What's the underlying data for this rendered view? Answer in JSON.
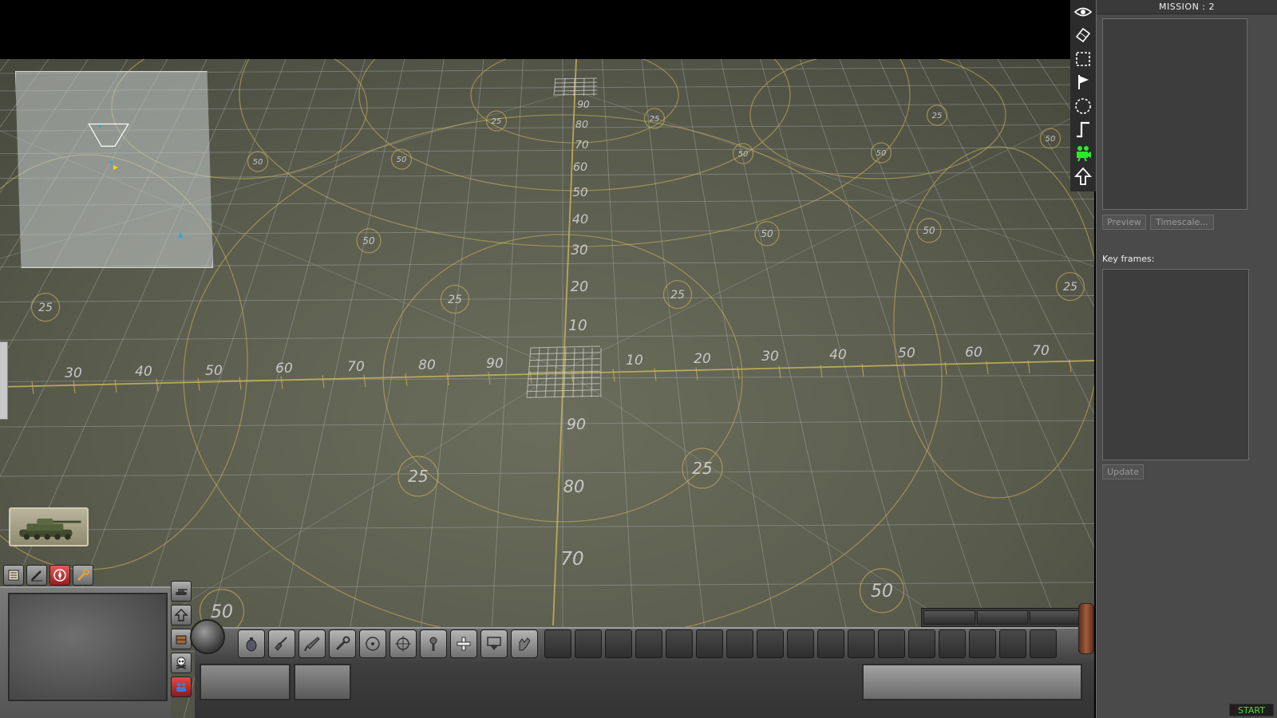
{
  "panel": {
    "title": "MISSION : 2",
    "preview_label": "Preview",
    "timescale_label": "Timescale...",
    "keyframes_label": "Key frames:",
    "update_label": "Update",
    "start_label": "START"
  },
  "tools": [
    {
      "name": "eye-icon",
      "active": false
    },
    {
      "name": "eraser-icon",
      "active": false
    },
    {
      "name": "selection-icon",
      "active": false
    },
    {
      "name": "flag-icon",
      "active": false
    },
    {
      "name": "circle-icon",
      "active": false
    },
    {
      "name": "path-icon",
      "active": false
    },
    {
      "name": "camera-icon",
      "active": true
    },
    {
      "name": "arrow-up-icon",
      "active": false
    }
  ],
  "map": {
    "range_labels_horizontal": [
      "30",
      "40",
      "50",
      "60",
      "70",
      "80",
      "90",
      "10",
      "20",
      "30",
      "40",
      "50",
      "60",
      "70"
    ],
    "range_labels_vertical_far": [
      "90",
      "80",
      "70",
      "60",
      "50",
      "40",
      "30",
      "20",
      "10"
    ],
    "range_labels_vertical_near": [
      "90",
      "80",
      "70"
    ],
    "ring_labels": [
      "25",
      "50"
    ],
    "line_color": "#c8b45a",
    "grid_color": "#b9bfc1"
  },
  "hud": {
    "tabs": [
      "list-icon",
      "pencil-icon",
      "compass-icon",
      "wrench-icon"
    ],
    "active_tab": "compass-icon",
    "vertical_buttons": [
      "tank-icon",
      "arrow-up-icon",
      "crate-icon",
      "skull-icon",
      "flag-team-icon"
    ],
    "actions": [
      "grenade-icon",
      "shovel-icon",
      "knife-icon",
      "wrench-icon",
      "target-icon",
      "crosshair-icon",
      "repair-icon",
      "plus-icon",
      "drop-icon",
      "hand-icon"
    ],
    "empty_slots": 17
  }
}
